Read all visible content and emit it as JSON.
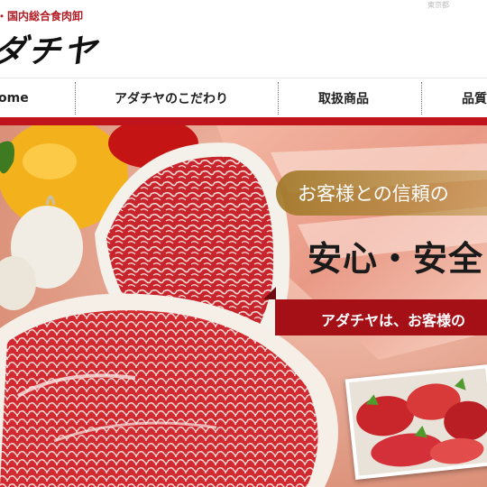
{
  "header": {
    "tagline": "・国内総合食肉卸",
    "logo_text": "ダチヤ",
    "corner_text": "東京都"
  },
  "nav": {
    "items": [
      {
        "label": "ome"
      },
      {
        "label": "アダチヤのこだわり"
      },
      {
        "label": "取扱商品"
      },
      {
        "label": "品質"
      }
    ]
  },
  "hero": {
    "pill_text": "お客様との信頼の",
    "headline": "安心・安全",
    "band_text": "アダチヤは、お客様の"
  },
  "colors": {
    "accent_red": "#c0141c",
    "band_red": "#a50f16",
    "pill_gold": "#b58a3c"
  }
}
